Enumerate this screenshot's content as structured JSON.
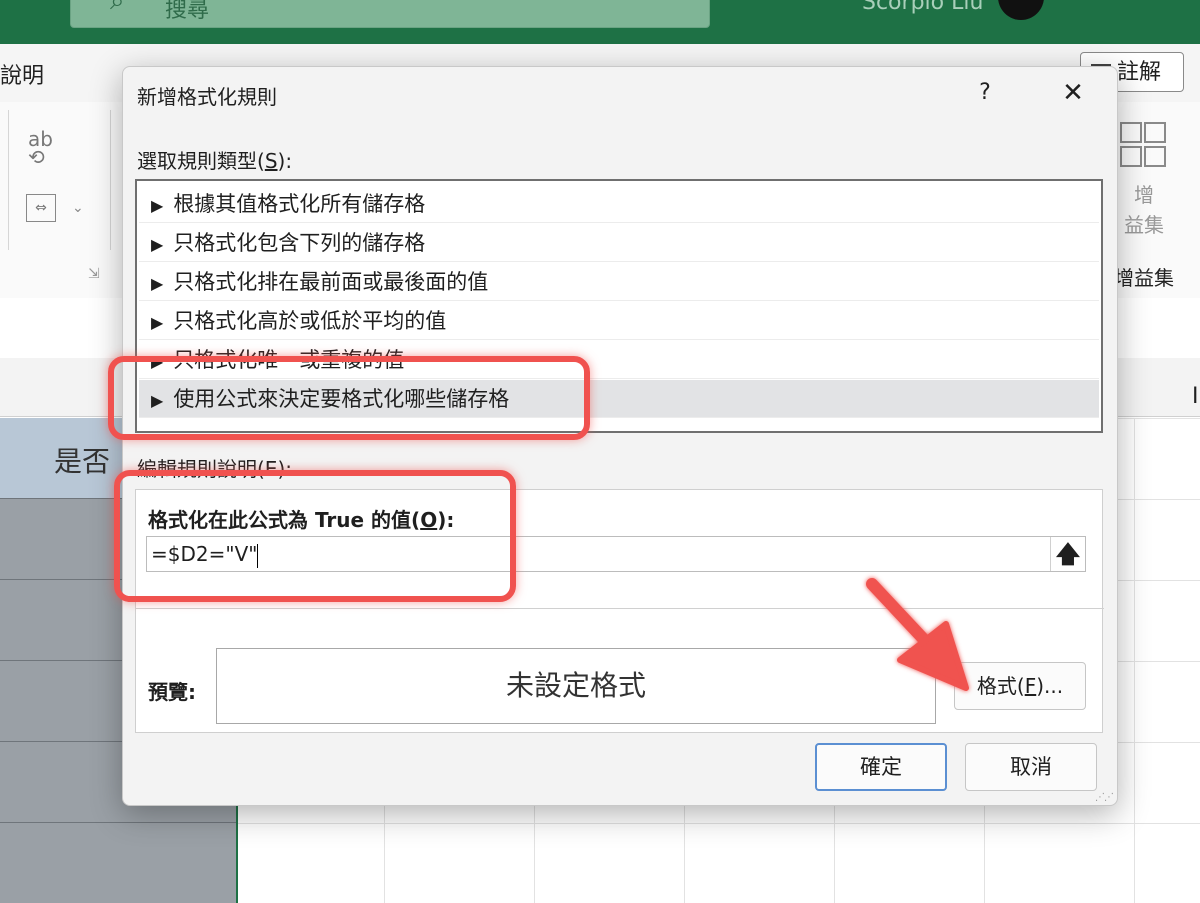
{
  "excel": {
    "search_placeholder": "搜尋",
    "user_name": "Scorpio Liu",
    "tab_help": "說明",
    "comment_button": "註解",
    "spell_icon_text": "ab",
    "addins_label_line1": "增",
    "addins_label_line2": "益集",
    "addins_group": "增益集",
    "column_i": "I",
    "header_cell_text": "是否"
  },
  "dialog": {
    "title": "新增格式化規則",
    "help_label": "?",
    "close_label": "✕",
    "select_rule_type_label": "選取規則類型(",
    "select_rule_type_key": "S",
    "select_rule_type_suffix": "):",
    "rule_arrow": "▶",
    "rule_types": [
      "根據其值格式化所有儲存格",
      "只格式化包含下列的儲存格",
      "只格式化排在最前面或最後面的值",
      "只格式化高於或低於平均的值",
      "只格式化唯一或重複的值",
      "使用公式來決定要格式化哪些儲存格"
    ],
    "edit_description_label": "編輯規則說明(E):",
    "formula_label": "格式化在此公式為 True 的值(",
    "formula_label_key": "O",
    "formula_label_suffix": "):",
    "formula_value": "=$D2=\"V\"",
    "collapse_glyph": "🡅",
    "preview_label": "預覽:",
    "preview_text": "未設定格式",
    "format_button": "格式(",
    "format_button_key": "F",
    "format_button_suffix": ")...",
    "ok_button": "確定",
    "cancel_button": "取消"
  },
  "colors": {
    "excel_green": "#1e7145",
    "highlight_red": "#f0524f",
    "ok_border_blue": "#5b8fd2"
  }
}
